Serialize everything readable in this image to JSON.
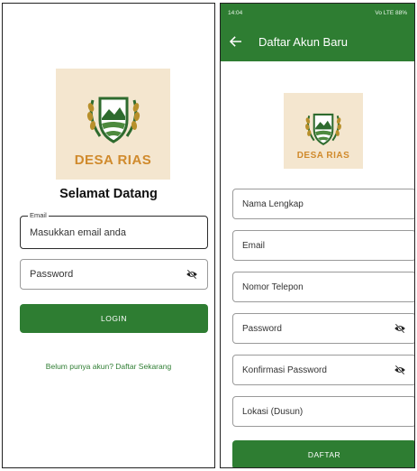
{
  "login": {
    "logo_text": "DESA RIAS",
    "welcome": "Selamat Datang",
    "email_label": "Email",
    "email_placeholder": "Masukkan email anda",
    "password_label": "Password",
    "login_button": "LOGIN",
    "signup_link": "Belum punya akun? Daftar Sekarang"
  },
  "register": {
    "status_time": "14:04",
    "status_right": "Vo LTE 88%",
    "title": "Daftar Akun Baru",
    "logo_text": "DESA RIAS",
    "fields": [
      "Nama Lengkap",
      "Email",
      "Nomor Telepon",
      "Password",
      "Konfirmasi Password",
      "Lokasi (Dusun)"
    ],
    "submit_button": "DAFTAR"
  },
  "colors": {
    "primary_green": "#2e7d32",
    "logo_background": "#f4e6cf",
    "logo_text": "#d08a2c"
  },
  "icons": [
    "eye-off-icon",
    "back-arrow-icon",
    "wheat-shield-logo"
  ]
}
